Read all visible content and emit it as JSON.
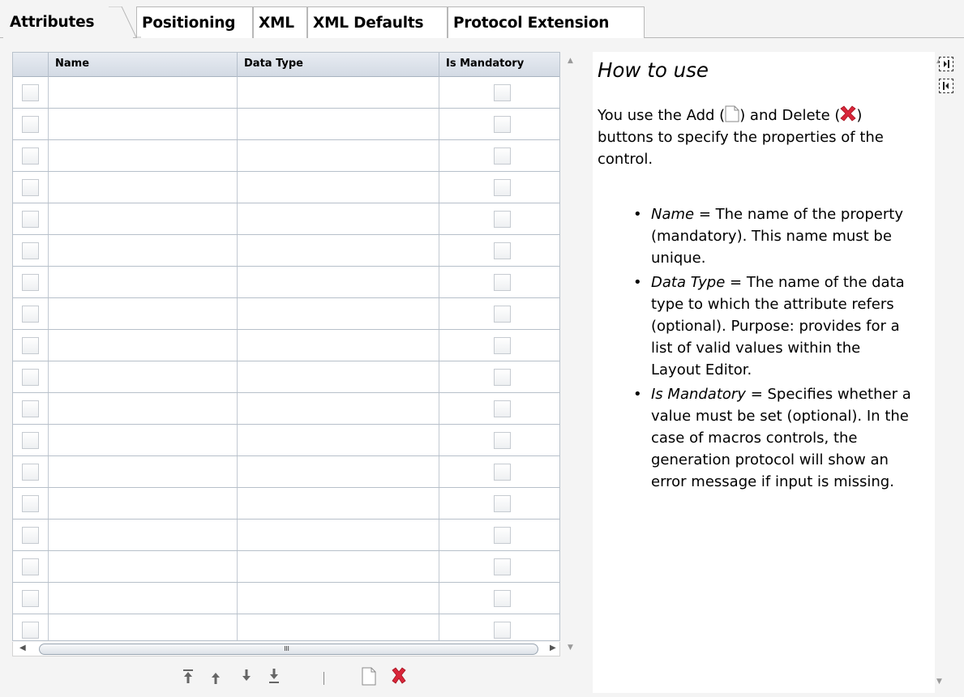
{
  "tabs": [
    {
      "label": "Attributes",
      "active": true
    },
    {
      "label": "Positioning",
      "active": false
    },
    {
      "label": "XML",
      "active": false
    },
    {
      "label": "XML Defaults",
      "active": false
    },
    {
      "label": "Protocol Extension",
      "active": false
    }
  ],
  "grid": {
    "columns": [
      "Name",
      "Data Type",
      "Is Mandatory"
    ],
    "row_count": 18
  },
  "toolbar": {
    "buttons": [
      "move-to-top",
      "move-up",
      "move-down",
      "move-to-bottom",
      "add",
      "delete"
    ]
  },
  "help": {
    "title": "How to use",
    "intro_part1": "You use the Add (",
    "intro_part2": ") and Delete (",
    "intro_part3": ") buttons to specify the properties of the control.",
    "items": [
      {
        "term": "Name",
        "text": " = The name of the property (mandatory). This name must be unique."
      },
      {
        "term": "Data Type",
        "text": " = The name of the data type to which the attribute refers (optional). Purpose: provides for a list of valid values within the Layout Editor."
      },
      {
        "term": "Is Mandatory",
        "text": " = Specifies whether a value must be set (optional). In the case of macros controls, the generation protocol will show an error message if input is missing."
      }
    ]
  },
  "colors": {
    "delete_red": "#d9263a",
    "grid_header": "#d8dee6",
    "panel_bg": "#ffffff"
  }
}
